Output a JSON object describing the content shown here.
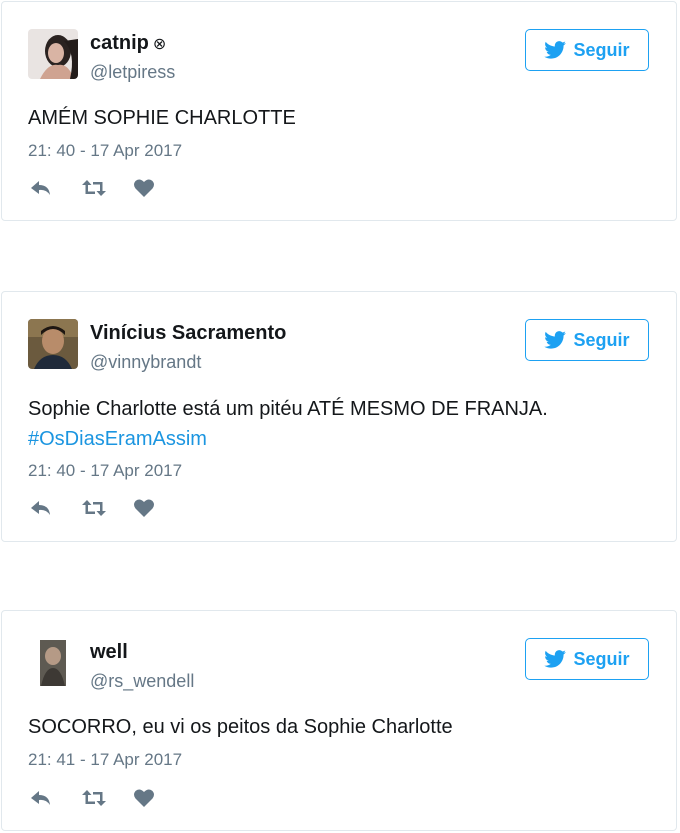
{
  "tweets": [
    {
      "name": "catnip",
      "badge": "⊗",
      "handle": "@letpiress",
      "follow_label": "Seguir",
      "text": "AMÉM SOPHIE CHARLOTTE",
      "hashtag": "",
      "time": "21: 40 - 17 Apr 2017"
    },
    {
      "name": "Vinícius Sacramento",
      "badge": "",
      "handle": "@vinnybrandt",
      "follow_label": "Seguir",
      "text": "Sophie Charlotte está um pitéu ATÉ MESMO DE FRANJA.",
      "hashtag": "#OsDiasEramAssim",
      "time": "21: 40 - 17 Apr 2017"
    },
    {
      "name": "well",
      "badge": "",
      "handle": "@rs_wendell",
      "follow_label": "Seguir",
      "text": "SOCORRO, eu vi os peitos da Sophie Charlotte",
      "hashtag": "",
      "time": "21: 41 - 17 Apr 2017"
    }
  ],
  "colors": {
    "accent": "#1da1f2",
    "hashtag": "#1b95e0",
    "muted": "#657786",
    "border": "#e1e8ed"
  },
  "icons": {
    "follow": "twitter-bird-icon",
    "actions": [
      "reply-icon",
      "retweet-icon",
      "like-icon"
    ]
  }
}
